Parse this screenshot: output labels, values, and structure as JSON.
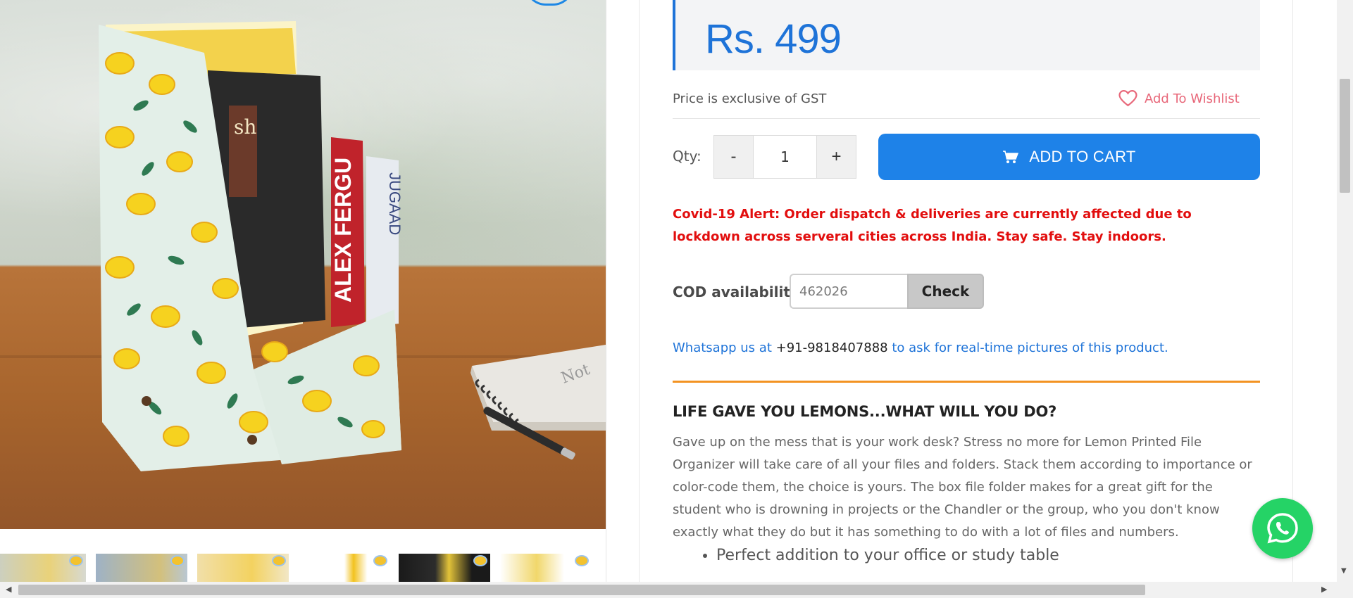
{
  "product": {
    "price": "Rs. 499",
    "gst_note": "Price is exclusive of GST",
    "wishlist_label": "Add To Wishlist",
    "qty_label": "Qty:",
    "qty_minus": "-",
    "qty_value": "1",
    "qty_plus": "+",
    "add_to_cart_label": "ADD TO CART",
    "accent_color": "#1e82e8"
  },
  "alert": {
    "text": "Covid-19 Alert: Order dispatch & deliveries are currently affected due to lockdown across serveral cities across India. Stay safe. Stay indoors.",
    "color": "#e20e0e"
  },
  "cod": {
    "label": "COD availability",
    "pincode_value": "462026",
    "check_label": "Check"
  },
  "whatsapp": {
    "prefix": "Whatsapp us at",
    "phone": "+91-9818407888",
    "suffix": "to ask for real-time pictures of this product."
  },
  "description": {
    "title": "LIFE GAVE YOU LEMONS...WHAT WILL YOU DO?",
    "body": "Gave up on the mess that is your work desk? Stress no more for Lemon Printed File Organizer will take care of all your files and folders. Stack them according to importance or color-code them, the choice is yours. The box file folder makes for a great gift for the student who is drowning in projects or the Chandler or the group, who you don't know exactly what they do but it has something to do with a lot of files and numbers.",
    "bullets": [
      "Perfect addition to your office or study table"
    ]
  },
  "icons": {
    "wishlist": "heart-icon",
    "cart": "cart-icon",
    "whatsapp_float": "whatsapp-icon"
  }
}
